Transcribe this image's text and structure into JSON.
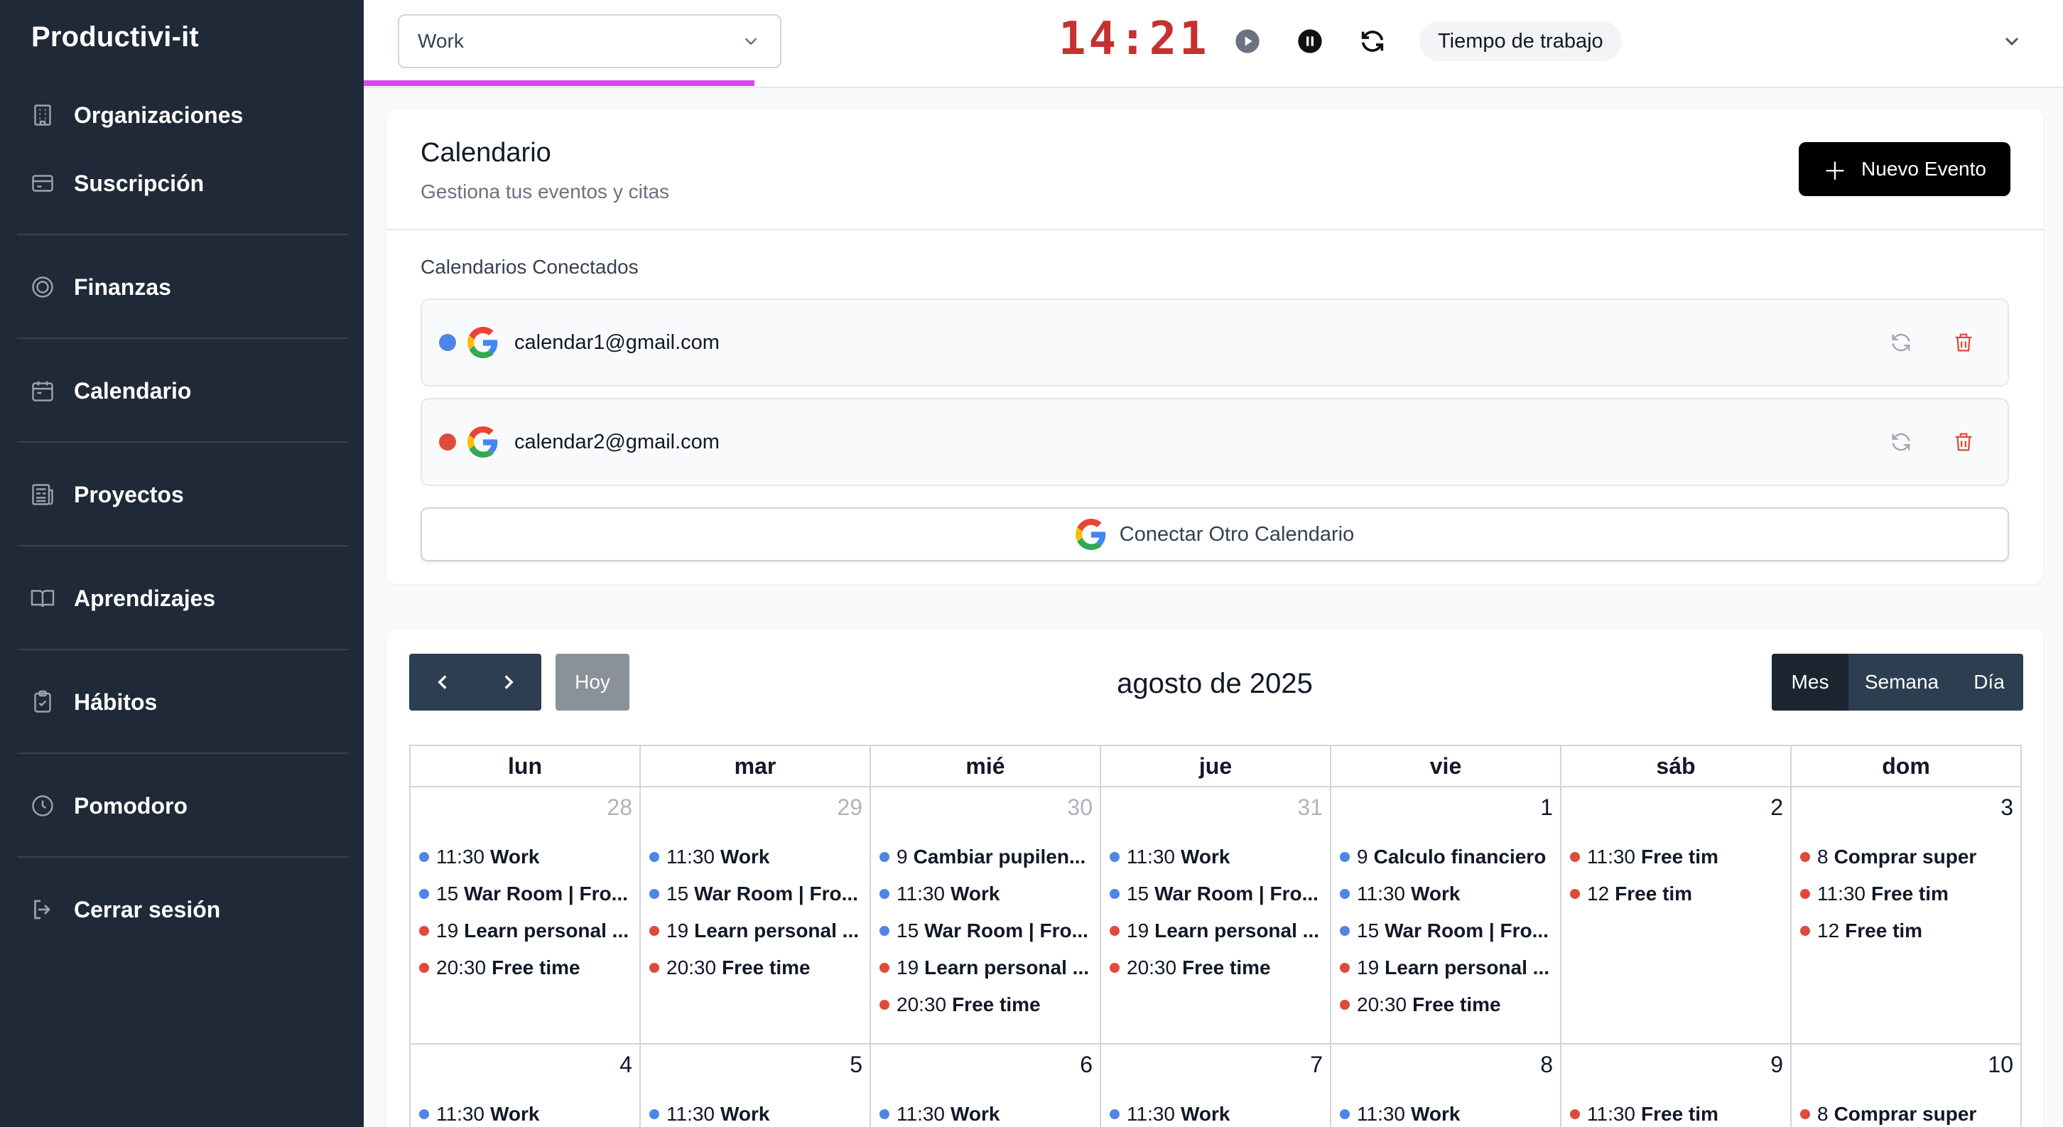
{
  "colors": {
    "sidebar_bg": "#1f2937",
    "accent_progress": "#d946ef",
    "timer": "#c53030",
    "calendar1": "#4f84e8",
    "calendar2": "#e04a3a",
    "toolbar_dark": "#2c3e50"
  },
  "sidebar": {
    "brand": "Productivi-it",
    "items": [
      {
        "label": "Organizaciones",
        "icon": "building-icon"
      },
      {
        "label": "Suscripción",
        "icon": "credit-card-icon"
      },
      {
        "label": "Finanzas",
        "icon": "target-icon"
      },
      {
        "label": "Calendario",
        "icon": "calendar-icon"
      },
      {
        "label": "Proyectos",
        "icon": "newspaper-icon"
      },
      {
        "label": "Aprendizajes",
        "icon": "book-icon"
      },
      {
        "label": "Hábitos",
        "icon": "clipboard-check-icon"
      },
      {
        "label": "Pomodoro",
        "icon": "clock-icon"
      },
      {
        "label": "Cerrar sesión",
        "icon": "logout-icon"
      }
    ]
  },
  "topbar": {
    "project": "Work",
    "timer": "14:21",
    "progress_percent": 23,
    "mode": "Tiempo de trabajo"
  },
  "calendars": {
    "title": "Calendario",
    "subtitle": "Gestiona tus eventos y citas",
    "new_event_label": "Nuevo Evento",
    "section_label": "Calendarios Conectados",
    "accounts": [
      {
        "email": "calendar1@gmail.com",
        "color": "#4f84e8"
      },
      {
        "email": "calendar2@gmail.com",
        "color": "#e04a3a"
      }
    ],
    "connect_label": "Conectar Otro Calendario"
  },
  "month": {
    "title": "agosto de 2025",
    "today_label": "Hoy",
    "views": [
      "Mes",
      "Semana",
      "Día"
    ],
    "active_view": "Mes",
    "weekdays": [
      "lun",
      "mar",
      "mié",
      "jue",
      "vie",
      "sáb",
      "dom"
    ],
    "weeks": [
      [
        {
          "num": "28",
          "other": true,
          "events": [
            {
              "time": "11:30",
              "title": "Work",
              "color": "#4f84e8"
            },
            {
              "time": "15",
              "title": "War Room | Fro...",
              "color": "#4f84e8"
            },
            {
              "time": "19",
              "title": "Learn personal ...",
              "color": "#e04a3a"
            },
            {
              "time": "20:30",
              "title": "Free time",
              "color": "#e04a3a"
            }
          ]
        },
        {
          "num": "29",
          "other": true,
          "events": [
            {
              "time": "11:30",
              "title": "Work",
              "color": "#4f84e8"
            },
            {
              "time": "15",
              "title": "War Room | Fro...",
              "color": "#4f84e8"
            },
            {
              "time": "19",
              "title": "Learn personal ...",
              "color": "#e04a3a"
            },
            {
              "time": "20:30",
              "title": "Free time",
              "color": "#e04a3a"
            }
          ]
        },
        {
          "num": "30",
          "other": true,
          "events": [
            {
              "time": "9",
              "title": "Cambiar pupilen...",
              "color": "#4f84e8"
            },
            {
              "time": "11:30",
              "title": "Work",
              "color": "#4f84e8"
            },
            {
              "time": "15",
              "title": "War Room | Fro...",
              "color": "#4f84e8"
            },
            {
              "time": "19",
              "title": "Learn personal ...",
              "color": "#e04a3a"
            },
            {
              "time": "20:30",
              "title": "Free time",
              "color": "#e04a3a"
            }
          ]
        },
        {
          "num": "31",
          "other": true,
          "events": [
            {
              "time": "11:30",
              "title": "Work",
              "color": "#4f84e8"
            },
            {
              "time": "15",
              "title": "War Room | Fro...",
              "color": "#4f84e8"
            },
            {
              "time": "19",
              "title": "Learn personal ...",
              "color": "#e04a3a"
            },
            {
              "time": "20:30",
              "title": "Free time",
              "color": "#e04a3a"
            }
          ]
        },
        {
          "num": "1",
          "other": false,
          "events": [
            {
              "time": "9",
              "title": "Calculo financiero",
              "color": "#4f84e8"
            },
            {
              "time": "11:30",
              "title": "Work",
              "color": "#4f84e8"
            },
            {
              "time": "15",
              "title": "War Room | Fro...",
              "color": "#4f84e8"
            },
            {
              "time": "19",
              "title": "Learn personal ...",
              "color": "#e04a3a"
            },
            {
              "time": "20:30",
              "title": "Free time",
              "color": "#e04a3a"
            }
          ]
        },
        {
          "num": "2",
          "other": false,
          "events": [
            {
              "time": "11:30",
              "title": "Free tim",
              "color": "#e04a3a"
            },
            {
              "time": "12",
              "title": "Free tim",
              "color": "#e04a3a"
            }
          ]
        },
        {
          "num": "3",
          "other": false,
          "events": [
            {
              "time": "8",
              "title": "Comprar super",
              "color": "#e04a3a"
            },
            {
              "time": "11:30",
              "title": "Free tim",
              "color": "#e04a3a"
            },
            {
              "time": "12",
              "title": "Free tim",
              "color": "#e04a3a"
            }
          ]
        }
      ],
      [
        {
          "num": "4",
          "other": false,
          "events": [
            {
              "time": "11:30",
              "title": "Work",
              "color": "#4f84e8"
            }
          ]
        },
        {
          "num": "5",
          "other": false,
          "events": [
            {
              "time": "11:30",
              "title": "Work",
              "color": "#4f84e8"
            }
          ]
        },
        {
          "num": "6",
          "other": false,
          "events": [
            {
              "time": "11:30",
              "title": "Work",
              "color": "#4f84e8"
            }
          ]
        },
        {
          "num": "7",
          "other": false,
          "events": [
            {
              "time": "11:30",
              "title": "Work",
              "color": "#4f84e8"
            }
          ]
        },
        {
          "num": "8",
          "other": false,
          "events": [
            {
              "time": "11:30",
              "title": "Work",
              "color": "#4f84e8"
            }
          ]
        },
        {
          "num": "9",
          "other": false,
          "events": [
            {
              "time": "11:30",
              "title": "Free tim",
              "color": "#e04a3a"
            }
          ]
        },
        {
          "num": "10",
          "other": false,
          "events": [
            {
              "time": "8",
              "title": "Comprar super",
              "color": "#e04a3a"
            }
          ]
        }
      ]
    ]
  }
}
